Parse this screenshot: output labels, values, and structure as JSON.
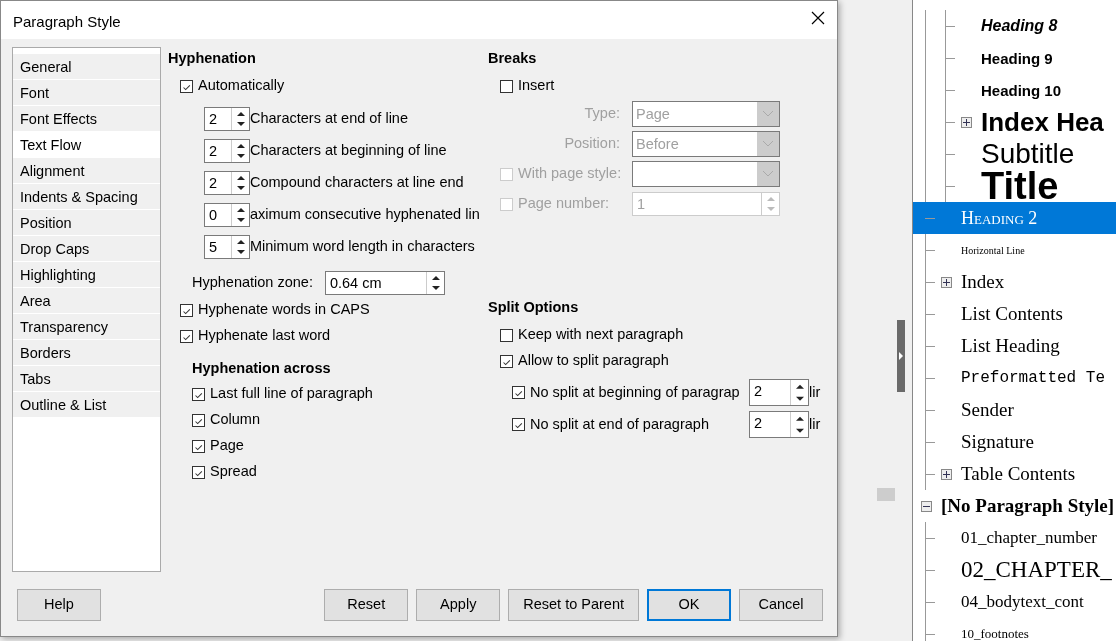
{
  "dialog": {
    "title": "Paragraph Style",
    "sidebar": [
      {
        "label": "General",
        "selected": false
      },
      {
        "label": "Font",
        "selected": false
      },
      {
        "label": "Font Effects",
        "selected": false
      },
      {
        "label": "Text Flow",
        "selected": true
      },
      {
        "label": "Alignment",
        "selected": false
      },
      {
        "label": "Indents & Spacing",
        "selected": false
      },
      {
        "label": "Position",
        "selected": false
      },
      {
        "label": "Drop Caps",
        "selected": false
      },
      {
        "label": "Highlighting",
        "selected": false
      },
      {
        "label": "Area",
        "selected": false
      },
      {
        "label": "Transparency",
        "selected": false
      },
      {
        "label": "Borders",
        "selected": false
      },
      {
        "label": "Tabs",
        "selected": false
      },
      {
        "label": "Outline & List",
        "selected": false
      }
    ],
    "hyphenation": {
      "heading": "Hyphenation",
      "automatically": {
        "label": "Automatically",
        "checked": true
      },
      "spins": [
        {
          "value": "2",
          "label": "Characters at end of line"
        },
        {
          "value": "2",
          "label": "Characters at beginning of line"
        },
        {
          "value": "2",
          "label": "Compound characters at line end"
        },
        {
          "value": "0",
          "label": "aximum consecutive hyphenated lin"
        },
        {
          "value": "5",
          "label": "Minimum word length in characters"
        }
      ],
      "zone": {
        "label": "Hyphenation zone:",
        "value": "0.64 cm"
      },
      "options": [
        {
          "label": "Hyphenate words in CAPS",
          "checked": true
        },
        {
          "label": "Hyphenate last word",
          "checked": true
        }
      ],
      "across_heading": "Hyphenation across",
      "across": [
        {
          "label": "Last full line of paragraph",
          "checked": true
        },
        {
          "label": "Column",
          "checked": true
        },
        {
          "label": "Page",
          "checked": true
        },
        {
          "label": "Spread",
          "checked": true
        }
      ]
    },
    "breaks": {
      "heading": "Breaks",
      "insert": {
        "label": "Insert",
        "checked": false
      },
      "rows": [
        {
          "kind": "select",
          "label": "Type:",
          "value": "Page",
          "disabled": true
        },
        {
          "kind": "select",
          "label": "Position:",
          "value": "Before",
          "disabled": true
        },
        {
          "kind": "checkselect",
          "label": "With page style:",
          "checked": false,
          "disabled": true
        },
        {
          "kind": "checkspin",
          "label": "Page number:",
          "value": "1",
          "checked": false,
          "disabled": true
        }
      ]
    },
    "split": {
      "heading": "Split Options",
      "options": [
        {
          "label": "Keep with next paragraph",
          "checked": false
        },
        {
          "label": "Allow to split paragraph",
          "checked": true
        }
      ],
      "lines": [
        {
          "label": "No split at beginning of paragrap",
          "checked": true,
          "value": "2",
          "suffix": "lir"
        },
        {
          "label": "No split at end of paragraph",
          "checked": true,
          "value": "2",
          "suffix": "lir"
        }
      ]
    },
    "buttons_left": [
      {
        "label": "Help",
        "default": false
      }
    ],
    "buttons_right": [
      {
        "label": "Reset",
        "default": false
      },
      {
        "label": "Apply",
        "default": false
      },
      {
        "label": "Reset to Parent",
        "default": false
      },
      {
        "label": "OK",
        "default": true
      },
      {
        "label": "Cancel",
        "default": false
      }
    ]
  },
  "styles_tree": [
    {
      "kind": "continued",
      "children": [
        {
          "kind": "continued",
          "children": [
            {
              "label": "Heading 8",
              "kind": "italichead",
              "selected": false
            },
            {
              "label": "Heading 9",
              "kind": "boldhead",
              "selected": false
            },
            {
              "label": "Heading 10",
              "kind": "boldhead",
              "selected": false
            },
            {
              "label": "Index Hea",
              "kind": "bighead",
              "selected": false,
              "expanded": false
            },
            {
              "label": "Subtitle",
              "kind": "subtitle",
              "selected": false
            },
            {
              "label": "Title",
              "kind": "title",
              "selected": false
            }
          ]
        },
        {
          "label": "Heading 2",
          "kind": "smallcaps",
          "selected": true
        },
        {
          "label": "Horizontal Line",
          "kind": "tiny",
          "selected": false
        },
        {
          "label": "Index",
          "kind": "serif",
          "selected": false,
          "expanded": false
        },
        {
          "label": "List Contents",
          "kind": "serif",
          "selected": false
        },
        {
          "label": "List Heading",
          "kind": "serif",
          "selected": false
        },
        {
          "label": "Preformatted Te",
          "kind": "mono",
          "selected": false
        },
        {
          "label": "Sender",
          "kind": "serif",
          "selected": false
        },
        {
          "label": "Signature",
          "kind": "serif",
          "selected": false
        },
        {
          "label": "Table Contents",
          "kind": "serif",
          "selected": false,
          "expanded": false
        }
      ]
    },
    {
      "label": "[No Paragraph Style]",
      "kind": "rootbold",
      "selected": false,
      "expanded": true,
      "children": [
        {
          "label": "01_chapter_number",
          "kind": "serifsmall",
          "selected": false
        },
        {
          "label": "02_CHAPTER_",
          "kind": "huge",
          "selected": false
        },
        {
          "label": "04_bodytext_cont",
          "kind": "serifsmall",
          "selected": false
        },
        {
          "label": "10_footnotes",
          "kind": "footnote",
          "selected": false
        }
      ]
    }
  ]
}
